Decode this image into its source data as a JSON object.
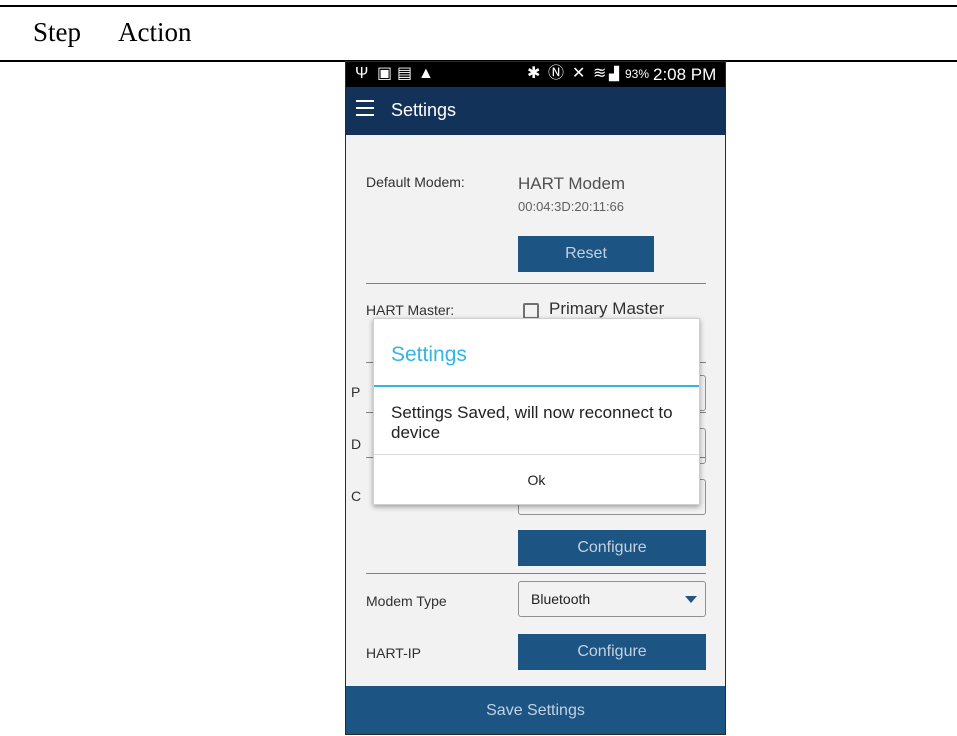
{
  "document": {
    "col_step": "Step",
    "col_action": "Action"
  },
  "status_bar": {
    "icons": [
      "usb-icon",
      "image-icon",
      "sim-icon",
      "warning-icon",
      "bluetooth-icon",
      "nfc-icon",
      "mute-icon",
      "wifi-icon",
      "signal-icon",
      "battery-charging-icon"
    ],
    "battery_pct": "93%",
    "time": "2:08 PM"
  },
  "app_bar": {
    "title": "Settings"
  },
  "settings": {
    "default_modem_label": "Default Modem:",
    "modem_name": "HART Modem",
    "modem_address": "00:04:3D:20:11:66",
    "reset_label": "Reset",
    "hart_master_label": "HART Master:",
    "primary_master_label": "Primary Master",
    "hidden_field_initials": [
      "P",
      "D",
      "C"
    ],
    "configure_label": "Configure",
    "modem_type_label": "Modem Type",
    "modem_type_value": "Bluetooth",
    "hart_ip_label": "HART-IP",
    "hart_ip_configure_label": "Configure"
  },
  "bottom_bar": {
    "save_label": "Save Settings"
  },
  "dialog": {
    "title": "Settings",
    "message": "Settings Saved, will now reconnect to device",
    "ok_label": "Ok"
  },
  "colors": {
    "app_bar": "#133259",
    "primary_button": "#1e5a8c",
    "dialog_accent": "#33b5e5"
  }
}
